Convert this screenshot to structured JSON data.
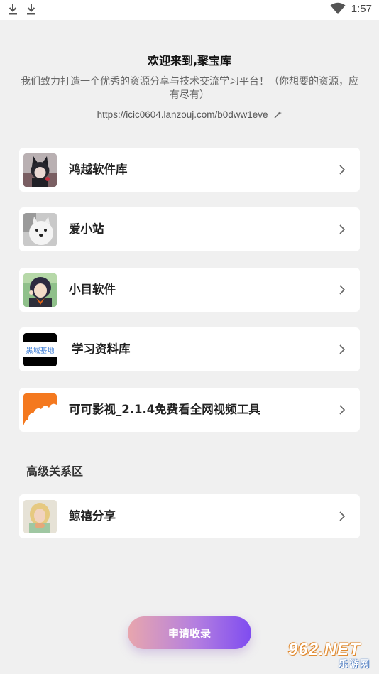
{
  "status_bar": {
    "time": "1:57",
    "left_icons": [
      "download-icon",
      "download-icon"
    ],
    "right_icons": [
      "wifi-icon"
    ]
  },
  "header": {
    "title": "欢迎来到,聚宝库",
    "description": "我们致力打造一个优秀的资源分享与技术交流学习平台！（你想要的资源，应有尽有）",
    "link": "https://icic0604.lanzouj.com/b0dww1eve"
  },
  "items": [
    {
      "label": "鸿越软件库"
    },
    {
      "label": "爱小站"
    },
    {
      "label": "小目软件"
    },
    {
      "label": "学习资料库",
      "thumb_text": "黑域基地"
    },
    {
      "label": "可可影视_2.1.4免费看全网视频工具"
    }
  ],
  "advanced_section": {
    "title": "高级关系区",
    "items": [
      {
        "label": "鲸禧分享"
      }
    ]
  },
  "apply_button": {
    "label": "申请收录"
  },
  "watermark": {
    "top": "962.NET",
    "bottom": "乐游网"
  },
  "colors": {
    "background": "#f0f0f0",
    "card": "#ffffff",
    "button_gradient_start": "#e8a6ad",
    "button_gradient_end": "#7f4cf0"
  }
}
